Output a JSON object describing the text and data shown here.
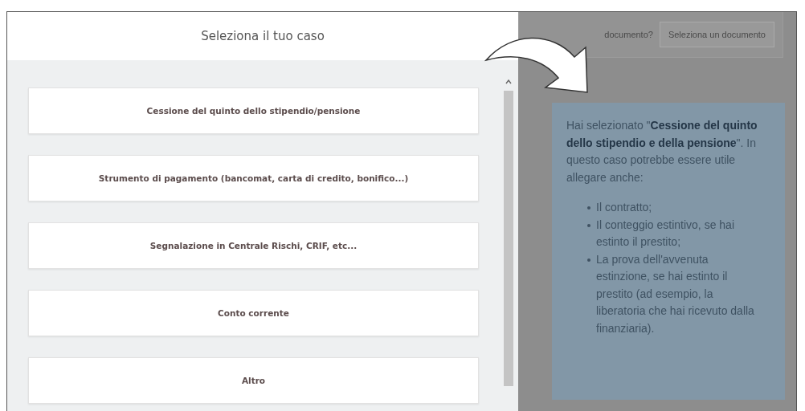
{
  "modal": {
    "title": "Seleziona il tuo caso",
    "options": [
      {
        "label": "Cessione del quinto dello stipendio/pensione"
      },
      {
        "label": "Strumento di pagamento (bancomat, carta di credito, bonifico...)"
      },
      {
        "label": "Segnalazione in Centrale Rischi, CRIF, etc..."
      },
      {
        "label": "Conto corrente"
      },
      {
        "label": "Altro"
      }
    ]
  },
  "document_bar": {
    "prompt": "documento?",
    "button": "Seleziona un documento"
  },
  "info": {
    "text": "Hai selezionato \"**Cessione del quinto dello stipendio e della pensione**\". In questo caso potrebbe essere utile allegare anche:",
    "items": [
      "Il contratto;",
      "Il conteggio estintivo, se hai estinto il prestito;",
      "La prova dell'avvenuta estinzione, se hai estinto il prestito (ad esempio, la liberatoria che hai ricevuto dalla finanziaria)."
    ]
  }
}
